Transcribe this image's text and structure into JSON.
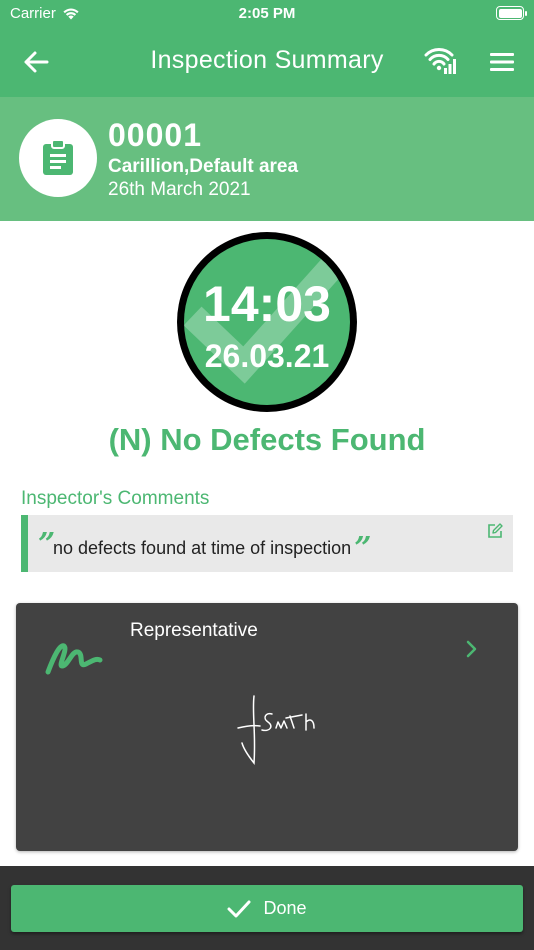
{
  "status_bar": {
    "carrier": "Carrier",
    "time": "2:05 PM"
  },
  "nav": {
    "title": "Inspection Summary",
    "back_icon": "arrow-left-icon",
    "signal_icon": "wifi-signal-icon",
    "menu_icon": "hamburger-menu-icon"
  },
  "header": {
    "code": "00001",
    "site": "Carillion,Default area",
    "date": "26th March 2021",
    "icon": "clipboard-icon"
  },
  "badge": {
    "time": "14:03",
    "date": "26.03.21"
  },
  "result": {
    "label": "(N) No Defects Found"
  },
  "comments": {
    "label": "Inspector's Comments",
    "open_quote": "”",
    "text": "no defects found at time of inspection",
    "close_quote": "”",
    "edit_icon": "edit-icon"
  },
  "signature": {
    "title": "Representative",
    "icon": "signature-icon",
    "chevron": "chevron-right-icon"
  },
  "actions": {
    "done_label": "Done"
  },
  "colors": {
    "primary": "#4cb772",
    "header": "#67bf80",
    "card": "#424242",
    "bottom": "#333333",
    "comment_bg": "#e9e9e9"
  }
}
